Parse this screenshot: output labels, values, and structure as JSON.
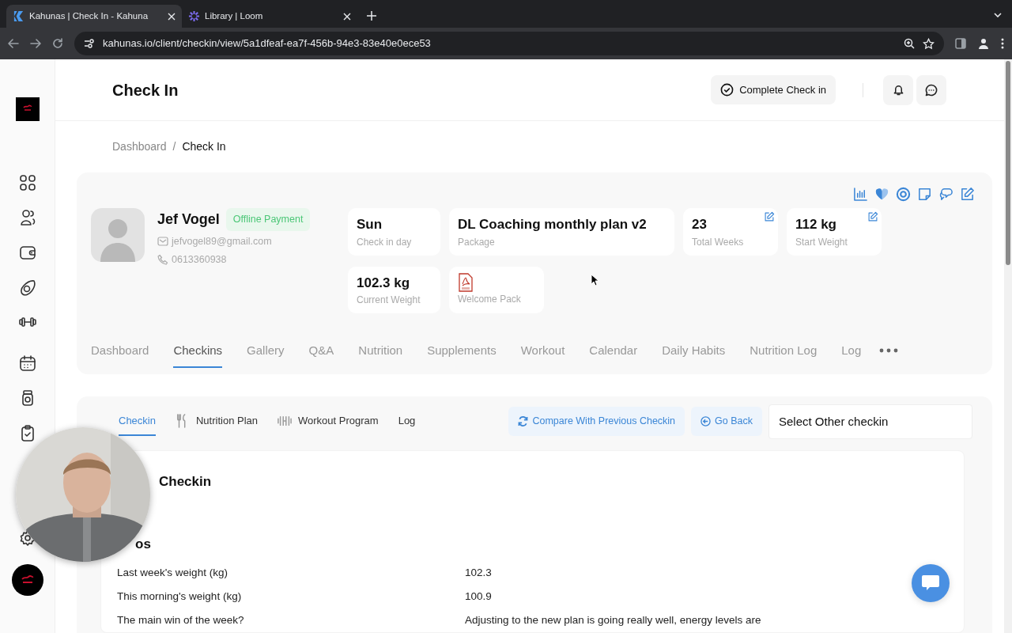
{
  "browser": {
    "tabs": [
      {
        "title": "Kahunas | Check In - Kahuna",
        "kind": "kahunas",
        "selected": true
      },
      {
        "title": "Library | Loom",
        "kind": "loom",
        "selected": false
      }
    ],
    "url": "kahunas.io/client/checkin/view/5a1dfeaf-ea7f-456b-94e3-83e40e0ece53"
  },
  "header": {
    "title": "Check In",
    "complete_button": "Complete Check in"
  },
  "breadcrumb": {
    "items": [
      "Dashboard",
      "Check In"
    ],
    "separator": "/"
  },
  "profile": {
    "name": "Jef Vogel",
    "badge": "Offline Payment",
    "email": "jefvogel89@gmail.com",
    "phone": "0613360938"
  },
  "stats": [
    {
      "kind": "value",
      "value": "Sun",
      "label": "Check in day",
      "editable": false
    },
    {
      "kind": "value",
      "value": "DL Coaching monthly plan v2",
      "label": "Package",
      "editable": false
    },
    {
      "kind": "value",
      "value": "23",
      "label": "Total Weeks",
      "editable": true
    },
    {
      "kind": "value",
      "value": "112 kg",
      "label": "Start Weight",
      "editable": true
    },
    {
      "kind": "value",
      "value": "102.3 kg",
      "label": "Current Weight",
      "editable": false
    },
    {
      "kind": "file",
      "label": "Welcome Pack",
      "editable": false
    }
  ],
  "tabs": [
    {
      "label": "Dashboard",
      "selected": false
    },
    {
      "label": "Checkins",
      "selected": true
    },
    {
      "label": "Gallery",
      "selected": false
    },
    {
      "label": "Q&A",
      "selected": false
    },
    {
      "label": "Nutrition",
      "selected": false
    },
    {
      "label": "Supplements",
      "selected": false
    },
    {
      "label": "Workout",
      "selected": false
    },
    {
      "label": "Calendar",
      "selected": false
    },
    {
      "label": "Daily Habits",
      "selected": false
    },
    {
      "label": "Nutrition Log",
      "selected": false
    },
    {
      "label": "Log",
      "selected": false
    }
  ],
  "subtabs": [
    {
      "label": "Checkin",
      "kind": "checkin",
      "selected": true
    },
    {
      "label": "Nutrition Plan",
      "kind": "nutrition",
      "selected": false
    },
    {
      "label": "Workout Program",
      "kind": "workout",
      "selected": false
    },
    {
      "label": "Log",
      "kind": "log",
      "selected": false
    }
  ],
  "actions": {
    "compare": "Compare With Previous Checkin",
    "back": "Go Back",
    "select_placeholder": "Select Other checkin"
  },
  "checkin": {
    "heading": "Checkin",
    "section": "os",
    "rows": [
      {
        "question": "Last week's weight (kg)",
        "answer": "102.3"
      },
      {
        "question": "This morning's weight (kg)",
        "answer": "100.9"
      },
      {
        "question": "The main win of the week?",
        "answer": "Adjusting to the new plan is going really well, energy levels are"
      }
    ]
  }
}
